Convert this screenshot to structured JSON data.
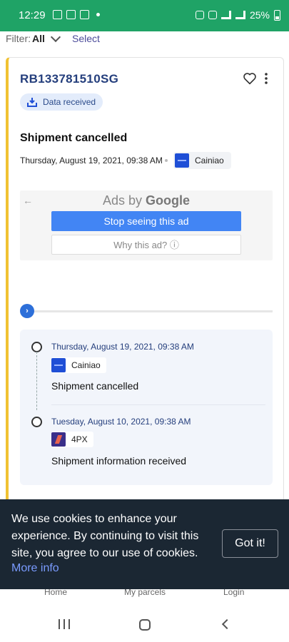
{
  "status_bar": {
    "time": "12:29",
    "battery": "25%"
  },
  "filter": {
    "label": "Filter:",
    "value": "All",
    "select_label": "Select"
  },
  "parcel": {
    "tracking_number": "RB133781510SG",
    "badge_label": "Data received",
    "status_title": "Shipment cancelled",
    "status_date": "Thursday, August 19, 2021, 09:38 AM",
    "carrier": "Cainiao"
  },
  "ad": {
    "title_prefix": "Ads by ",
    "title_brand": "Google",
    "stop_label": "Stop seeing this ad",
    "why_label": "Why this ad? ⓘ"
  },
  "timeline": [
    {
      "date": "Thursday, August 19, 2021, 09:38 AM",
      "carrier": "Cainiao",
      "text": "Shipment cancelled"
    },
    {
      "date": "Tuesday, August 10, 2021, 09:38 AM",
      "carrier": "4PX",
      "text": "Shipment information received"
    }
  ],
  "bottom_nav": {
    "home": "Home",
    "parcels": "My parcels",
    "login": "Login"
  },
  "cookie": {
    "text": "We use cookies to enhance your experience. By continuing to visit this site, you agree to our use of cookies.",
    "more_info": "More info",
    "button": "Got it!"
  },
  "colors": {
    "status_bar": "#1fa366",
    "accent": "#243e7c",
    "card_stripe": "#f1c232",
    "cookie_bg": "#1b2733"
  }
}
